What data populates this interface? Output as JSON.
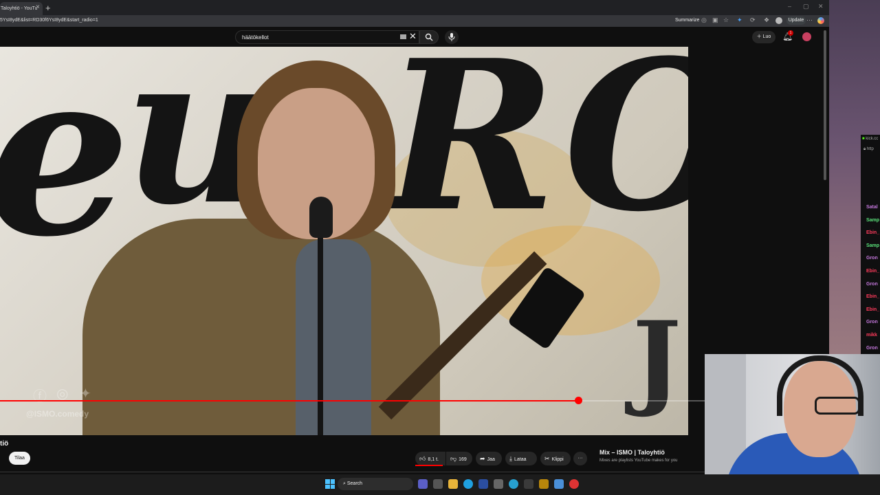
{
  "browser": {
    "tab_title": "Taloyhtiö - YouTu",
    "new_tab": "+",
    "url": "5YsI8ydE&list=RD30f6YsI8ydE&start_radio=1",
    "summarize_label": "Summarize",
    "update_label": "Update",
    "window_controls": [
      "–",
      "▢",
      "✕"
    ]
  },
  "youtube": {
    "search_value": "häätökellot",
    "create_label": "Luo",
    "notification_count": "1"
  },
  "video": {
    "watermark": "@ISMO.comedy",
    "progress": 0.82
  },
  "below_video": {
    "title_fragment": "tiö",
    "subscribe_label": "Tilaa",
    "like_count": "8,1 t.",
    "dislike_count": "169",
    "share_label": "Jaa",
    "download_label": "Lataa",
    "clip_label": "Klippi",
    "more_label": "···"
  },
  "mix": {
    "title": "Mix – ISMO | Taloyhtiö",
    "subtitle": "Mixes are playlists YouTube makes for you"
  },
  "taskbar": {
    "search_label": "Search"
  },
  "chat": {
    "window_label": "kick.cc",
    "url_fragment": "http",
    "users": [
      {
        "name": "Satal",
        "color": "#c678dd"
      },
      {
        "name": "Samp",
        "color": "#5be37b"
      },
      {
        "name": "Ebin_",
        "color": "#ff3b5c"
      },
      {
        "name": "Samp",
        "color": "#5be37b"
      },
      {
        "name": "Gron",
        "color": "#c678dd"
      },
      {
        "name": "Ebin_",
        "color": "#ff3b5c"
      },
      {
        "name": "Gron",
        "color": "#c678dd"
      },
      {
        "name": "Ebin_",
        "color": "#ff3b5c"
      },
      {
        "name": "Ebin_",
        "color": "#ff3b5c"
      },
      {
        "name": "Gron",
        "color": "#c678dd"
      },
      {
        "name": "mikk",
        "color": "#ff3b5c"
      },
      {
        "name": "Gron",
        "color": "#c678dd"
      }
    ]
  },
  "colors": {
    "accent_red": "#ff0000",
    "background": "#0f0f0f"
  }
}
